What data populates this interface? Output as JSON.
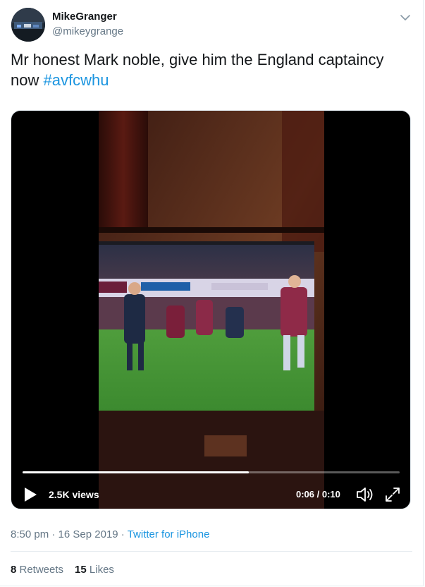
{
  "tweet": {
    "author": {
      "display_name": "MikeGranger",
      "handle": "@mikeygrange"
    },
    "text": {
      "body": "Mr honest Mark noble, give him the England captaincy now ",
      "hashtag": "#avfcwhu"
    },
    "video": {
      "views": "2.5K views",
      "time": "0:06 / 0:10",
      "progress": 0.6
    },
    "meta": {
      "time": "8:50 pm",
      "sep1": " · ",
      "date": "16 Sep 2019",
      "sep2": " · ",
      "source": "Twitter for iPhone"
    },
    "stats": {
      "retweets_count": "8",
      "retweets_label": " Retweets",
      "likes_count": "15",
      "likes_label": " Likes"
    }
  },
  "icons": {
    "caret": "chevron-down-icon",
    "play": "play-icon",
    "volume": "volume-icon",
    "fullscreen": "fullscreen-icon"
  },
  "colors": {
    "link": "#1b95e0",
    "secondary_text": "#657786",
    "primary_text": "#14171a",
    "divider": "#e6ecf0"
  }
}
